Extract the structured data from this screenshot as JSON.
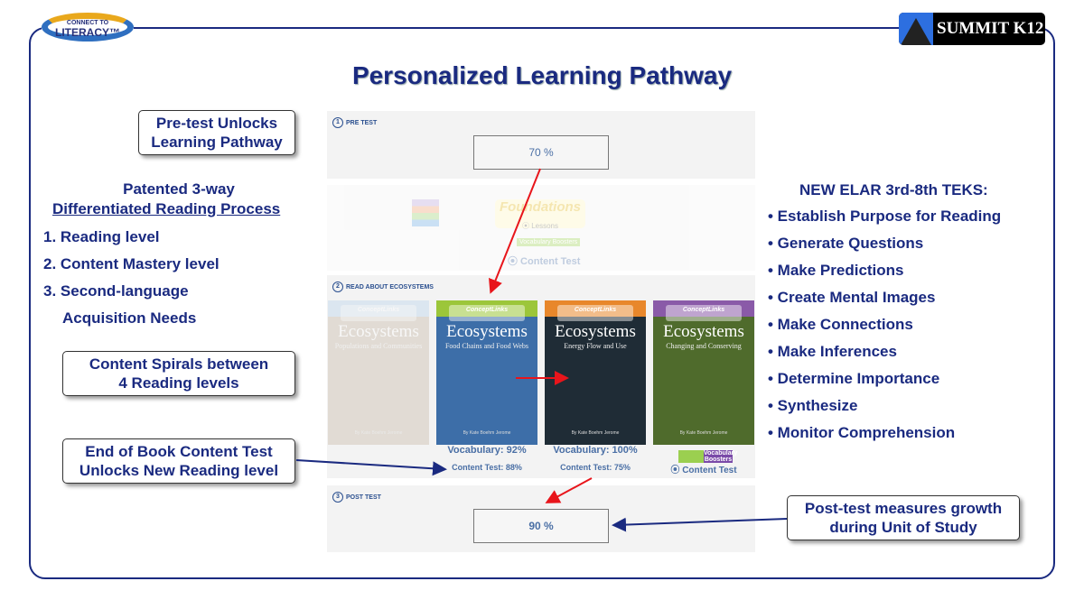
{
  "logos": {
    "left": "CONNECT TO LITERACY",
    "left_top": "CONNECT TO",
    "left_main": "LITERACY™",
    "right": "SUMMIT K12"
  },
  "title": "Personalized Learning Pathway",
  "callouts": {
    "pretest": [
      "Pre-test Unlocks",
      "Learning Pathway"
    ],
    "spirals": [
      "Content Spirals between",
      "4 Reading levels"
    ],
    "endbook": [
      "End of Book Content Test",
      "Unlocks New Reading level"
    ],
    "posttest": [
      "Post-test measures growth",
      "during Unit of Study"
    ]
  },
  "left": {
    "heading1": "Patented 3-way",
    "heading2": "Differentiated Reading Process",
    "items": [
      "1.  Reading level",
      "2.  Content Mastery level",
      "3.  Second-language",
      "Acquisition Needs"
    ]
  },
  "right": {
    "heading": "NEW ELAR 3rd-8th TEKS:",
    "items": [
      "• Establish Purpose for Reading",
      "• Generate Questions",
      "• Make Predictions",
      "• Create Mental Images",
      "• Make Connections",
      "• Make Inferences",
      "• Determine Importance",
      "• Synthesize",
      "• Monitor Comprehension"
    ]
  },
  "panel": {
    "pre": {
      "num": "1",
      "label": "PRE TEST",
      "score": "70 %"
    },
    "foundations": {
      "logo": "Foundations",
      "lessons": "⦿ Lessons",
      "vocab": "Vocabulary Boosters",
      "content_test": "⦿ Content Test"
    },
    "read": {
      "num": "2",
      "label": "READ ABOUT ECOSYSTEMS",
      "books": [
        {
          "series": "ConceptLinks",
          "title": "Ecosystems",
          "subtitle": "Populations and Communities",
          "byline": "By Kate Boehm Jerome",
          "color": "#b9d4ec",
          "faded": true
        },
        {
          "series": "ConceptLinks",
          "title": "Ecosystems",
          "subtitle": "Food Chains and Food Webs",
          "byline": "By Kate Boehm Jerome",
          "color": "#9cc63a",
          "vocab": "Vocabulary: 92%",
          "test": "Content Test: 88%"
        },
        {
          "series": "ConceptLinks",
          "title": "Ecosystems",
          "subtitle": "Energy Flow and Use",
          "byline": "By Kate Boehm Jerome",
          "color": "#e8872b",
          "vocab": "Vocabulary: 100%",
          "test": "Content Test: 75%"
        },
        {
          "series": "ConceptLinks",
          "title": "Ecosystems",
          "subtitle": "Changing and Conserving",
          "byline": "By Kate Boehm Jerome",
          "color": "#8a5aa8",
          "vocab_btn": "Vocabulary Boosters",
          "test_btn": "⦿ Content Test"
        }
      ]
    },
    "post": {
      "num": "3",
      "label": "POST TEST",
      "score": "90 %"
    }
  },
  "colors": {
    "navy": "#1a2a80",
    "arrow_red": "#e8151b",
    "panel_gray": "#f3f3f3",
    "score_text": "#4a6fa5"
  }
}
